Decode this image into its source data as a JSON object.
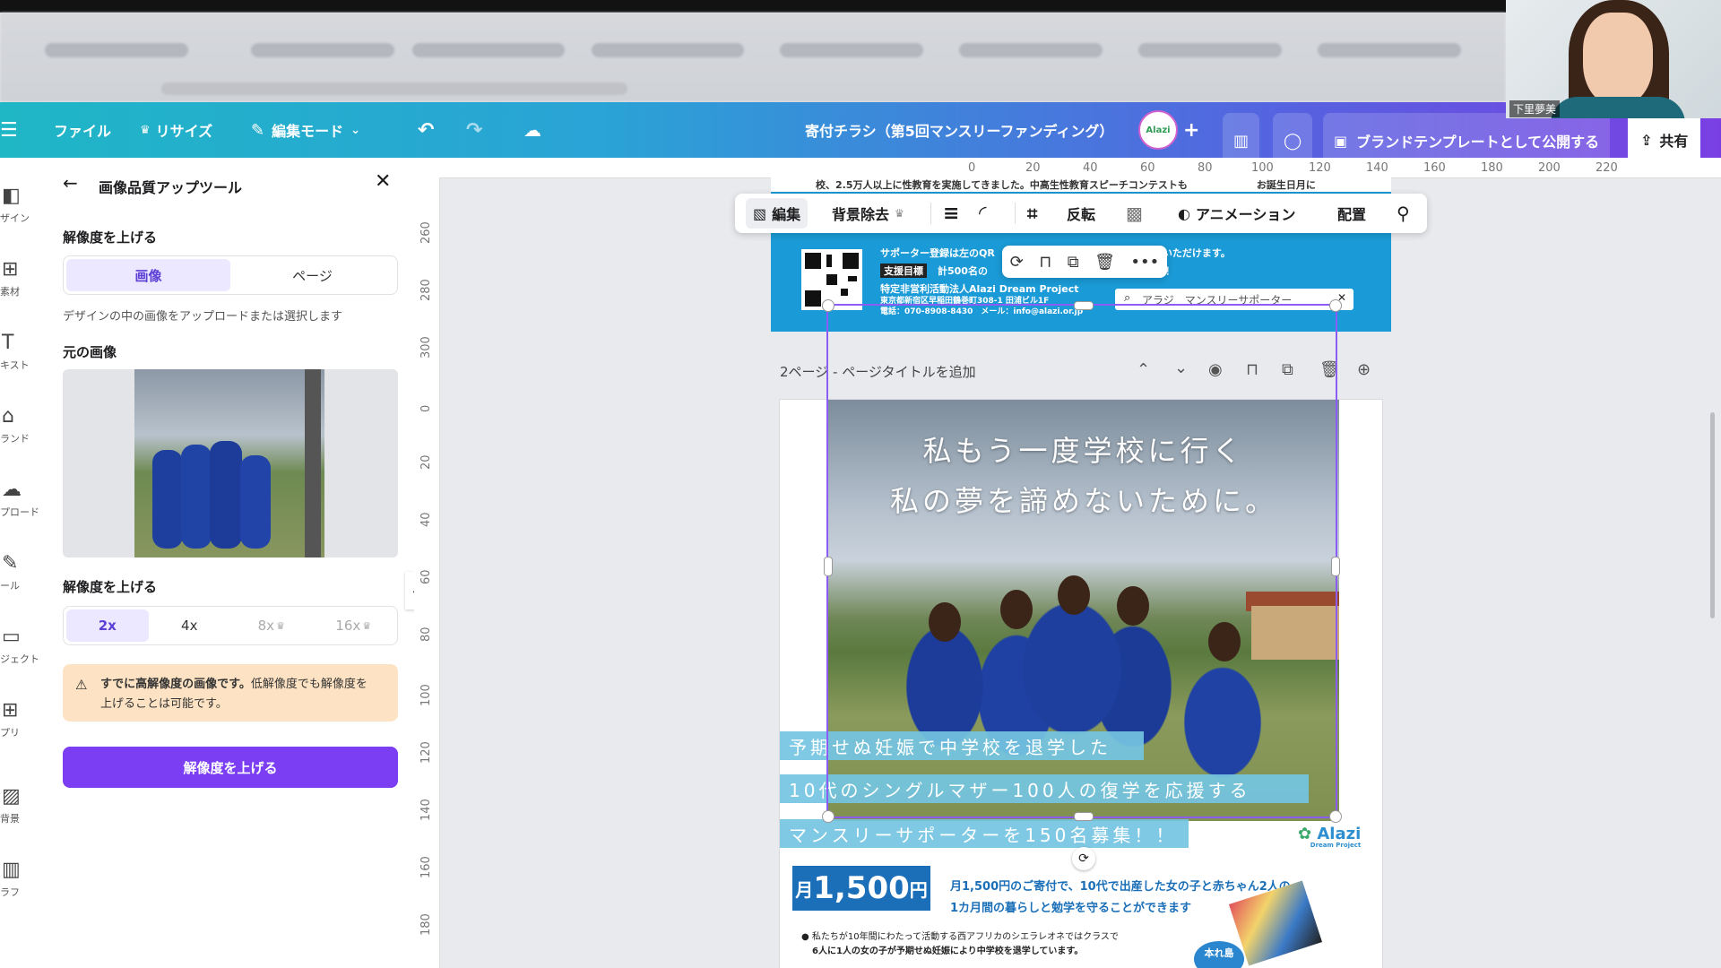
{
  "topbar": {
    "menu_icon": "hamburger-icon",
    "file": "ファイル",
    "resize": "リサイズ",
    "edit_mode": "編集モード",
    "doc_title": "寄付チラシ（第5回マンスリーファンディング）",
    "avatar_text": "Alazi",
    "brand_template": "ブランドテンプレートとして公開する",
    "share": "共有"
  },
  "rail": [
    {
      "label": "ザイン",
      "icon": "design-icon"
    },
    {
      "label": "素材",
      "icon": "elements-icon"
    },
    {
      "label": "キスト",
      "icon": "text-icon"
    },
    {
      "label": "ランド",
      "icon": "brand-icon"
    },
    {
      "label": "プロード",
      "icon": "upload-icon"
    },
    {
      "label": "ール",
      "icon": "draw-icon"
    },
    {
      "label": "ジェクト",
      "icon": "projects-icon"
    },
    {
      "label": "プリ",
      "icon": "apps-icon"
    },
    {
      "label": "背景",
      "icon": "background-icon"
    },
    {
      "label": "ラフ",
      "icon": "chart-icon"
    }
  ],
  "panel": {
    "title": "画像品質アップツール",
    "section1": "解像度を上げる",
    "tabs": [
      "画像",
      "ページ"
    ],
    "hint": "デザインの中の画像をアップロードまたは選択します",
    "original_label": "元の画像",
    "section2": "解像度を上げる",
    "scales": [
      "2x",
      "4x",
      "8x",
      "16x"
    ],
    "warning_bold": "すでに高解像度の画像です。",
    "warning_rest": "低解像度でも解像度を",
    "warning_line2": "上げることは可能です。",
    "button": "解像度を上げる"
  },
  "ruler": {
    "top": [
      "0",
      "20",
      "40",
      "60",
      "80",
      "100",
      "120",
      "140",
      "160",
      "180",
      "200",
      "220"
    ],
    "left": [
      "260",
      "280",
      "300",
      "0",
      "20",
      "40",
      "60",
      "80",
      "100",
      "120",
      "140",
      "160",
      "180"
    ]
  },
  "page1": {
    "top_text": "校、2.5万人以上に性教育を実施してきました。中高生性教育スピーチコンテストも　　　　　　　お誕生日月に",
    "line1": "サポーター登録は左のQR　　　　　　　　　　　　　　ご登録いただけます。",
    "badge": "支援目標",
    "line2": "計500名の　　　　　　　　　　　　　　ています！",
    "org": "特定非営利活動法人Alazi Dream Project",
    "address": "東京都新宿区早稲田鶴巻町308-1 田浦ビル1F",
    "contact": "電話：070-8908-8430　メール：info@alazi.or.jp",
    "search_text": "アラジ　マンスリーサポーター"
  },
  "context_toolbar": {
    "edit": "編集",
    "bg_remove": "背景除去",
    "flip": "反転",
    "animation": "アニメーション",
    "position": "配置"
  },
  "page2": {
    "header": "2ページ - ページタイトルを追加",
    "headline1": "私もう一度学校に行く",
    "headline2": "私の夢を諦めないために。",
    "band1": "予期せぬ妊娠で中学校を退学した",
    "band2": "10代のシングルマザー100人の復学を応援する",
    "band3": "マンスリーサポーターを150名募集！！",
    "logo": "Alazi",
    "logo_sub": "Dream Project",
    "price_prefix": "月",
    "price": "1,500",
    "price_unit": "円",
    "desc1": "月1,500円のご寄付で、10代で出産した女の子と赤ちゃん2人の",
    "desc2": "1カ月間の暮らしと勉学を守ることができます",
    "bullet1": "● 私たちが10年間にわたって活動する西アフリカのシエラレオネではクラスで",
    "bullet2": "6人に1人の女の子が予期せぬ妊娠により中学校を退学しています。",
    "bubble": "本れ島"
  },
  "webcam": {
    "name": "下里夢美"
  },
  "colors": {
    "accent": "#7b3ef2",
    "selection": "#8b5cf6",
    "warning_bg": "#fde3c3"
  }
}
